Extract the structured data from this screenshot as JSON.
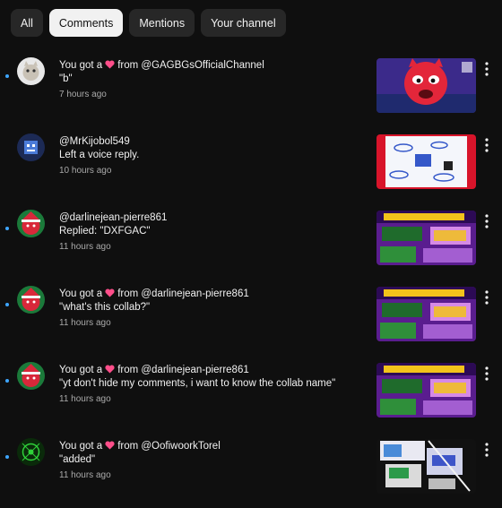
{
  "filters": [
    "All",
    "Comments",
    "Mentions",
    "Your channel"
  ],
  "selected_filter": "Comments",
  "notifications": [
    {
      "line1_prefix": "You got a",
      "line1_suffix": "from @GAGBGsOfficialChannel",
      "line2": "\"b\"",
      "time": "7 hours ago",
      "unread": true,
      "avatar": "cat-avatar-icon",
      "thumbnail": "red-monster-thumbnail"
    },
    {
      "line1": "@MrKijobol549",
      "line2": "Left a voice reply.",
      "time": "10 hours ago",
      "unread": false,
      "avatar": "blue-avatar-icon",
      "thumbnail": "level-83-thumbnail"
    },
    {
      "line1": "@darlinejean-pierre861",
      "line2": "Replied: \"DXFGAC\"",
      "time": "11 hours ago",
      "unread": true,
      "avatar": "christmas-avatar-icon",
      "thumbnail": "geometry-dash-thumbnail"
    },
    {
      "line1_prefix": "You got a",
      "line1_suffix": "from @darlinejean-pierre861",
      "line2": "\"what's this collab?\"",
      "time": "11 hours ago",
      "unread": true,
      "avatar": "christmas-avatar-icon",
      "thumbnail": "geometry-dash-thumbnail"
    },
    {
      "line1_prefix": "You got a",
      "line1_suffix": "from @darlinejean-pierre861",
      "line2": "\"yt don't hide my comments, i want to know the collab name\"",
      "time": "11 hours ago",
      "unread": true,
      "avatar": "christmas-avatar-icon",
      "thumbnail": "geometry-dash-thumbnail"
    },
    {
      "line1_prefix": "You got a",
      "line1_suffix": "from @OofiwoorkTorel",
      "line2": "\"added\"",
      "time": "11 hours ago",
      "unread": true,
      "avatar": "green-avatar-icon",
      "thumbnail": "collage-thumbnail"
    }
  ],
  "colors": {
    "background": "#0f0f0f",
    "chip": "#272727",
    "chip_active": "#f1f1f1",
    "unread_dot": "#3ea6ff",
    "heart": "#ff4e8a",
    "meta_text": "#aaaaaa"
  }
}
